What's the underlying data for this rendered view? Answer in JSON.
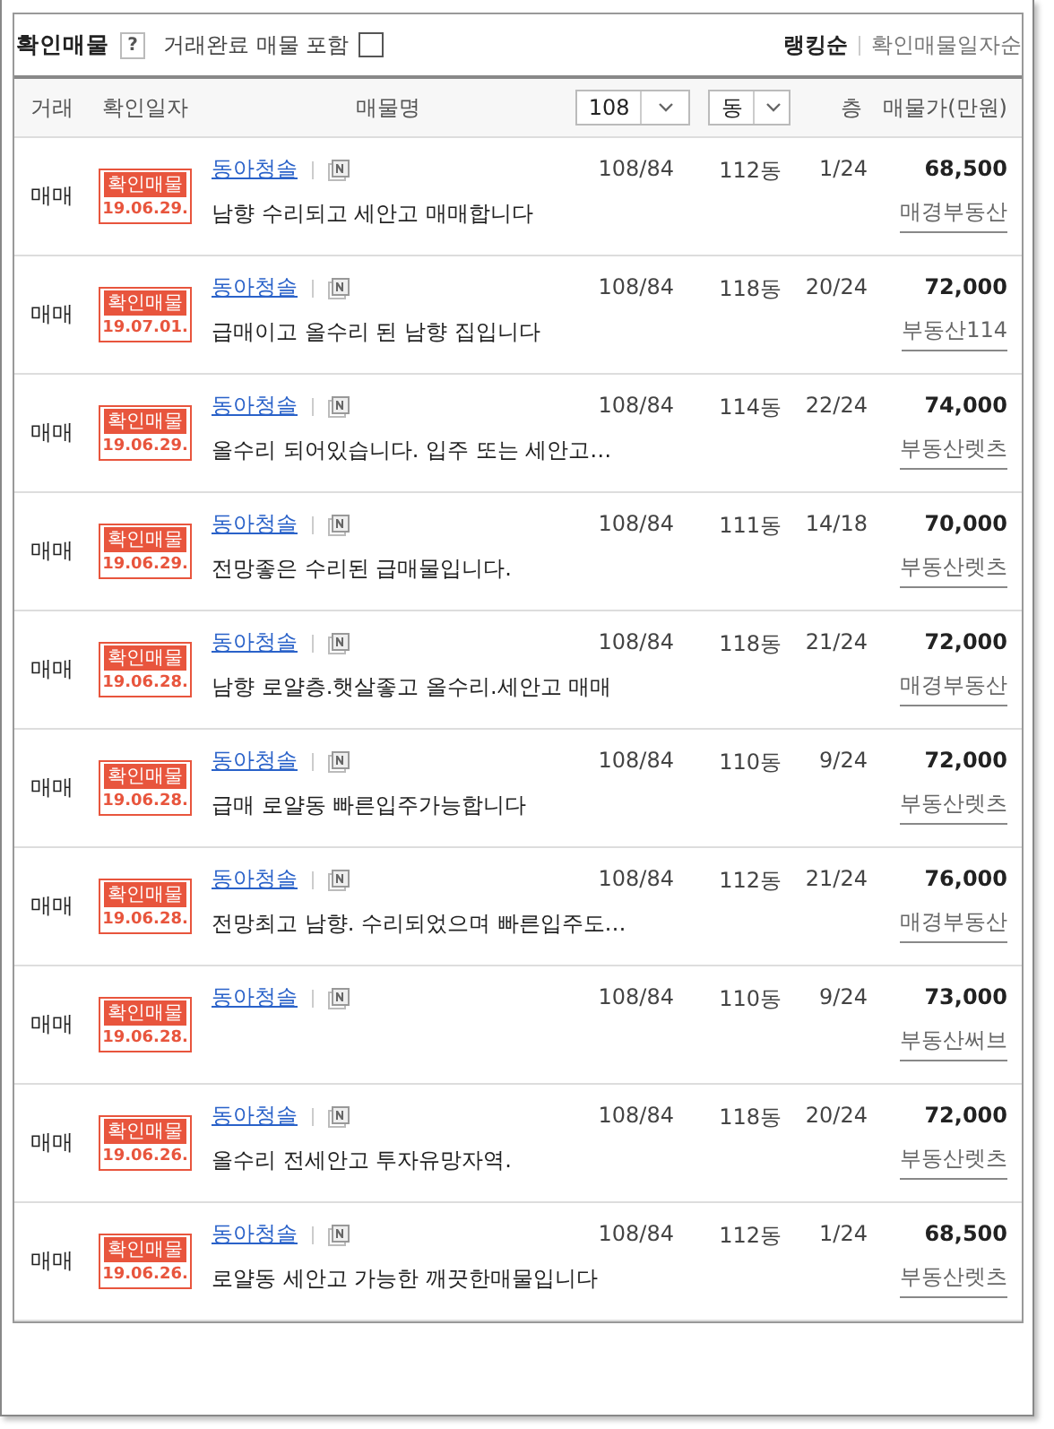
{
  "header": {
    "title": "확인매물",
    "help": "?",
    "include_done": {
      "label": "거래완료 매물 포함",
      "checked": false
    },
    "sort": [
      {
        "label": "랭킹순",
        "selected": true
      },
      {
        "label": "확인매물일자순",
        "selected": false
      }
    ]
  },
  "columns": {
    "deal": "거래",
    "date": "확인일자",
    "name": "매물명",
    "area_select": "108",
    "dong_select": "동",
    "floor": "층",
    "price": "매물가(만원)"
  },
  "rows": [
    {
      "deal": "매매",
      "badge": "확인매물",
      "date": "19.06.29.",
      "name": "동아청솔",
      "desc": "남향 수리되고 세안고 매매합니다",
      "area": "108/84",
      "dong": "112동",
      "floor": "1/24",
      "price": "68,500",
      "agency": "매경부동산"
    },
    {
      "deal": "매매",
      "badge": "확인매물",
      "date": "19.07.01.",
      "name": "동아청솔",
      "desc": "급매이고 올수리 된 남향 집입니다",
      "area": "108/84",
      "dong": "118동",
      "floor": "20/24",
      "price": "72,000",
      "agency": "부동산114"
    },
    {
      "deal": "매매",
      "badge": "확인매물",
      "date": "19.06.29.",
      "name": "동아청솔",
      "desc": "올수리 되어있습니다. 입주 또는 세안고…",
      "area": "108/84",
      "dong": "114동",
      "floor": "22/24",
      "price": "74,000",
      "agency": "부동산렛츠"
    },
    {
      "deal": "매매",
      "badge": "확인매물",
      "date": "19.06.29.",
      "name": "동아청솔",
      "desc": "전망좋은 수리된 급매물입니다.",
      "area": "108/84",
      "dong": "111동",
      "floor": "14/18",
      "price": "70,000",
      "agency": "부동산렛츠"
    },
    {
      "deal": "매매",
      "badge": "확인매물",
      "date": "19.06.28.",
      "name": "동아청솔",
      "desc": "남향 로얄층.햇살좋고 올수리.세안고 매매",
      "area": "108/84",
      "dong": "118동",
      "floor": "21/24",
      "price": "72,000",
      "agency": "매경부동산"
    },
    {
      "deal": "매매",
      "badge": "확인매물",
      "date": "19.06.28.",
      "name": "동아청솔",
      "desc": "급매 로얄동 빠른입주가능합니다",
      "area": "108/84",
      "dong": "110동",
      "floor": "9/24",
      "price": "72,000",
      "agency": "부동산렛츠"
    },
    {
      "deal": "매매",
      "badge": "확인매물",
      "date": "19.06.28.",
      "name": "동아청솔",
      "desc": "전망최고 남향. 수리되었으며 빠른입주도…",
      "area": "108/84",
      "dong": "112동",
      "floor": "21/24",
      "price": "76,000",
      "agency": "매경부동산"
    },
    {
      "deal": "매매",
      "badge": "확인매물",
      "date": "19.06.28.",
      "name": "동아청솔",
      "desc": "",
      "area": "108/84",
      "dong": "110동",
      "floor": "9/24",
      "price": "73,000",
      "agency": "부동산써브"
    },
    {
      "deal": "매매",
      "badge": "확인매물",
      "date": "19.06.26.",
      "name": "동아청솔",
      "desc": "올수리 전세안고 투자유망자역.",
      "area": "108/84",
      "dong": "118동",
      "floor": "20/24",
      "price": "72,000",
      "agency": "부동산렛츠"
    },
    {
      "deal": "매매",
      "badge": "확인매물",
      "date": "19.06.26.",
      "name": "동아청솔",
      "desc": "로얄동 세안고 가능한 깨끗한매물입니다",
      "area": "108/84",
      "dong": "112동",
      "floor": "1/24",
      "price": "68,500",
      "agency": "부동산렛츠"
    }
  ]
}
